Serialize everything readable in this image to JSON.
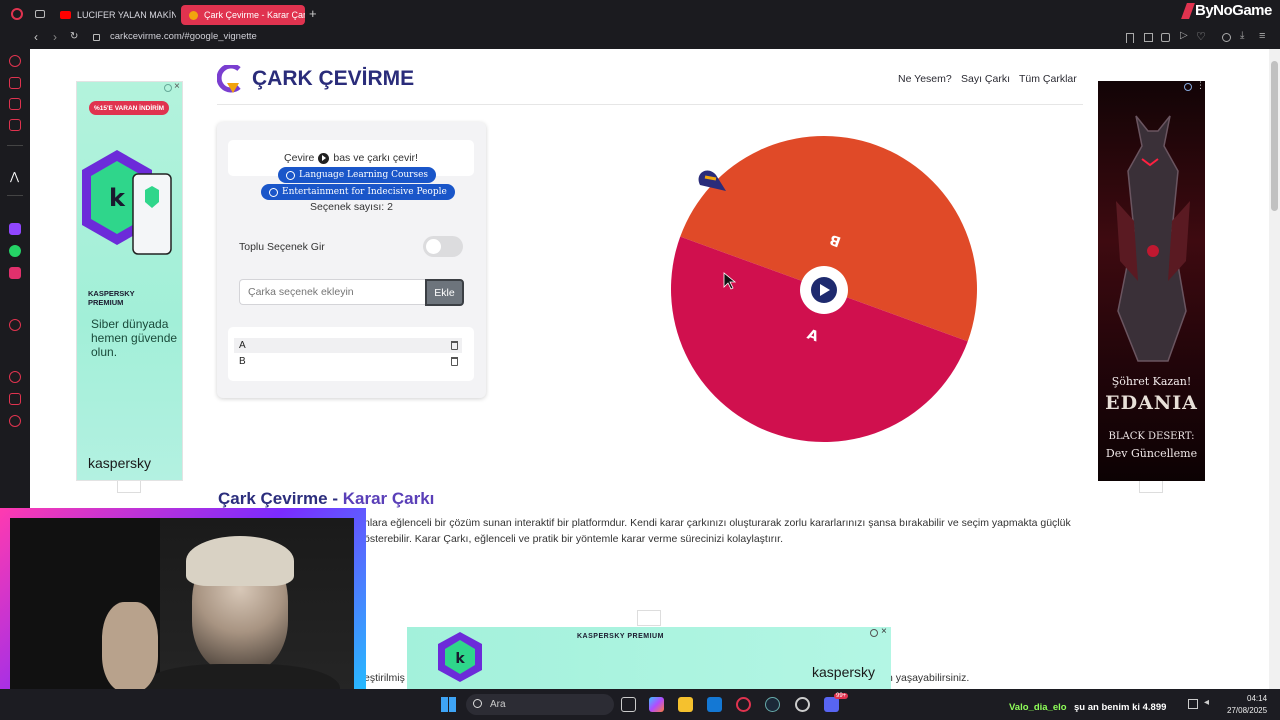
{
  "browser": {
    "tabs": [
      {
        "label": "LUCIFER YALAN MAKİNE"
      },
      {
        "label": "Çark Çevirme - Karar Çarkı"
      }
    ],
    "url": "carkcevirme.com/#google_vignette"
  },
  "overlay": {
    "brand": "ByNoGame"
  },
  "site": {
    "logo_text": "ÇARK ÇEVİRME",
    "nav": [
      "Ne Yesem?",
      "Sayı Çarkı",
      "Tüm Çarklar"
    ]
  },
  "panel": {
    "instruction_pre": "Çevire",
    "instruction_post": "bas ve çarkı çevir!",
    "pills": [
      "Language Learning Courses",
      "Entertainment for Indecisive People"
    ],
    "count_label": "Seçenek sayısı: 2",
    "bulk_label": "Toplu Seçenek Gir",
    "bulk_enabled": false,
    "input_placeholder": "Çarka seçenek ekleyin",
    "add_button": "Ekle",
    "options": [
      "A",
      "B"
    ]
  },
  "wheel": {
    "segments": [
      {
        "label": "B",
        "color": "#e04a28"
      },
      {
        "label": "A",
        "color": "#d0104e"
      }
    ]
  },
  "ads": {
    "left": {
      "badge": "%15'E VARAN İNDİRİM",
      "product": "KASPERSKY PREMIUM",
      "tagline": "Siber dünyada hemen güvende olun.",
      "brand": "kaspersky"
    },
    "right": {
      "top_text": "Şöhret Kazan!",
      "logo": "EDANIA",
      "sub": "BLACK DESERT:",
      "bottom_text": "Dev Güncelleme"
    },
    "bottom": {
      "product": "KASPERSKY PREMIUM",
      "brand": "kaspersky"
    }
  },
  "article": {
    "heading_a": "Çark Çevirme",
    "heading_sep": " - ",
    "heading_b": "Karar Çarkı",
    "line1": "nlara eğlenceli bir çözüm sunan interaktif bir platformdur. Kendi karar çarkınızı oluşturarak zorlu kararlarınızı şansa bırakabilir ve seçim yapmakta güçlük",
    "line2": "österebilir. Karar Çarkı, eğlenceli ve pratik bir yöntemle karar verme sürecinizi kolaylaştırır.",
    "bottom_left": "eştirilmiş",
    "bottom_right": "n yaşayabilirsiniz."
  },
  "taskbar": {
    "search": "Ara",
    "chat_user": "Valo_dia_elo",
    "chat_text": "şu an benim ki 4.899",
    "time": "04:14",
    "date": "27/08/2025",
    "badge": "99+"
  }
}
